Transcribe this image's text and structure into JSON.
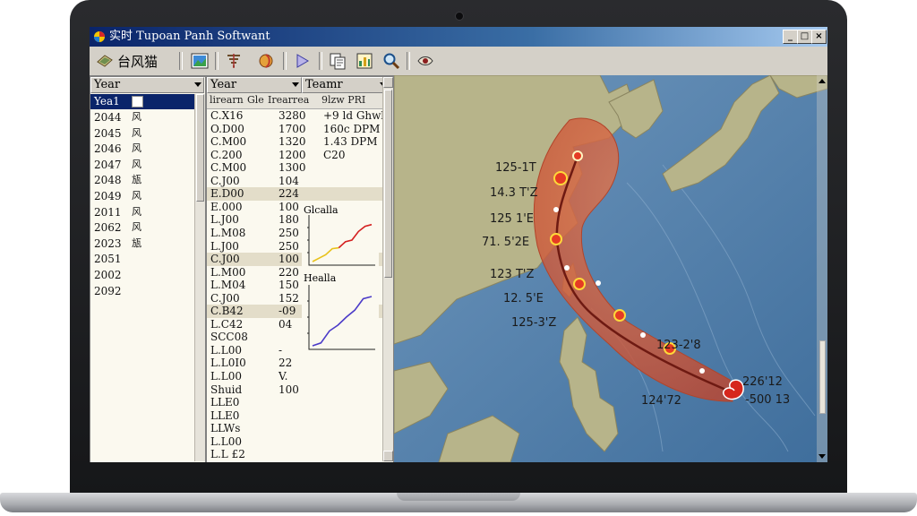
{
  "window": {
    "title": "实时 Tupoan Panh Softwant",
    "controls": [
      "_",
      "□",
      "×"
    ]
  },
  "toolbar": {
    "first_label": "台风猫",
    "icons": [
      "globe-icon",
      "image-icon",
      "typhoon-icon",
      "tornado-icon",
      "play-icon",
      "copy-icon",
      "chart-icon",
      "search-icon",
      "eye-icon"
    ]
  },
  "year_list": {
    "header": "Year",
    "selected": "Yea1",
    "rows": [
      {
        "year": "2044",
        "mark": "风"
      },
      {
        "year": "2045",
        "mark": "风"
      },
      {
        "year": "2046",
        "mark": "风"
      },
      {
        "year": "2047",
        "mark": "风"
      },
      {
        "year": "2048",
        "mark": "瓬"
      },
      {
        "year": "2049",
        "mark": "风"
      },
      {
        "year": "2011",
        "mark": "风"
      },
      {
        "year": "2062",
        "mark": "风"
      },
      {
        "year": "2023",
        "mark": "瓬"
      },
      {
        "year": "2051",
        "mark": ""
      },
      {
        "year": "2002",
        "mark": ""
      },
      {
        "year": "2092",
        "mark": ""
      }
    ]
  },
  "data_table": {
    "headers": [
      "Year",
      "Teamr"
    ],
    "subheaders": [
      "lirearn",
      "Gle",
      "Irearrea",
      "9lzw PRI"
    ],
    "rows": [
      {
        "c1": "C.X16",
        "c2": "3280",
        "c3": "+9 ld Ghwl"
      },
      {
        "c1": "O.D00",
        "c2": "1700",
        "c3": "160c DPM"
      },
      {
        "c1": "C.M00",
        "c2": "1320",
        "c3": "1.43 DPM"
      },
      {
        "c1": "C.200",
        "c2": "1200",
        "c3": "C20"
      },
      {
        "c1": "C.M00",
        "c2": "1300",
        "c3": ""
      },
      {
        "c1": "C.J00",
        "c2": "104",
        "c3": ""
      },
      {
        "c1": "E.D00",
        "c2": "224",
        "c3": ""
      },
      {
        "c1": "E.000",
        "c2": "100",
        "c3": ""
      },
      {
        "c1": "L.J00",
        "c2": "180",
        "c3": ""
      },
      {
        "c1": "L.M08",
        "c2": "250",
        "c3": ""
      },
      {
        "c1": "L.J00",
        "c2": "250",
        "c3": ""
      },
      {
        "c1": "C.J00",
        "c2": "100",
        "c3": ""
      },
      {
        "c1": "L.M00",
        "c2": "220",
        "c3": ""
      },
      {
        "c1": "L.M04",
        "c2": "150",
        "c3": ""
      },
      {
        "c1": "C.J00",
        "c2": "152",
        "c3": ""
      },
      {
        "c1": "C.B42",
        "c2": "-09",
        "c3": ""
      },
      {
        "c1": "L.C42",
        "c2": "04",
        "c3": ""
      },
      {
        "c1": "SCC08",
        "c2": "",
        "c3": ""
      },
      {
        "c1": "L.L00",
        "c2": "-",
        "c3": ""
      },
      {
        "c1": "L.L0I0",
        "c2": "22",
        "c3": ""
      },
      {
        "c1": "L.L00",
        "c2": "V.",
        "c3": ""
      },
      {
        "c1": "Shuid",
        "c2": "100",
        "c3": ""
      },
      {
        "c1": "LLE0",
        "c2": "",
        "c3": ""
      },
      {
        "c1": "LLE0",
        "c2": "",
        "c3": ""
      },
      {
        "c1": "LLWs",
        "c2": "",
        "c3": ""
      },
      {
        "c1": "L.L00",
        "c2": "",
        "c3": ""
      },
      {
        "c1": "L.L £2",
        "c2": "",
        "c3": ""
      }
    ]
  },
  "mini_charts": [
    {
      "title": "Glcalla",
      "series": [
        {
          "color": "#e8c21a",
          "values": [
            0,
            0.08,
            0.16,
            0.3,
            0.32
          ]
        },
        {
          "color": "#d42020",
          "values": [
            0.32,
            0.46,
            0.5,
            0.7,
            0.82,
            0.86
          ]
        }
      ]
    },
    {
      "title": "Healla",
      "series": [
        {
          "color": "#4b3bc8",
          "values": [
            0,
            0.05,
            0.26,
            0.36,
            0.5,
            0.62,
            0.82,
            0.86
          ]
        }
      ]
    }
  ],
  "map": {
    "track_labels": [
      "125-1T",
      "14.3 T'Z",
      "125 1'E",
      "71. 5'2E",
      "123 T'Z",
      "12. 5'E",
      "125-3'Z",
      "123-2'8",
      "226'12",
      "124'72",
      "-500 13"
    ],
    "colors": {
      "ocean": "#5a85ad",
      "land": "#b7b48a",
      "cone": "#d76a4a",
      "track": "#7a1e14",
      "storm": "#d6261c"
    }
  }
}
